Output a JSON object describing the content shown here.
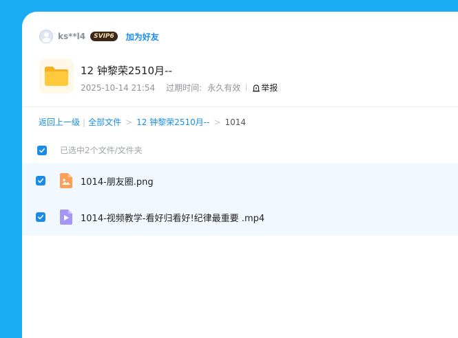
{
  "user": {
    "name": "ks**l4",
    "vip_label": "SVIP6",
    "add_friend_label": "加为好友"
  },
  "share": {
    "title": "12 钟黎荣2510月--",
    "date": "2025-10-14 21:54",
    "expiry_label": "过期时间:",
    "expiry_value": "永久有效",
    "report_label": "举报"
  },
  "breadcrumb": {
    "back_label": "返回上一级",
    "root_label": "全部文件",
    "folder_label": "12 钟黎荣2510月--",
    "current_label": "1014"
  },
  "selection": {
    "summary": "已选中2个文件/文件夹",
    "all_checked": true
  },
  "files": [
    {
      "name": "1014-朋友圈.png",
      "type": "image",
      "checked": true
    },
    {
      "name": "1014-视频教学-看好归看好!纪律最重要 .mp4",
      "type": "video",
      "checked": true
    }
  ],
  "colors": {
    "page_background": "#1aabf2",
    "accent": "#1a8ce8",
    "selected_row": "#f2f8ff",
    "image_icon": "#f9a15a",
    "video_icon": "#a497f6",
    "folder_icon": "#ffc93c"
  }
}
